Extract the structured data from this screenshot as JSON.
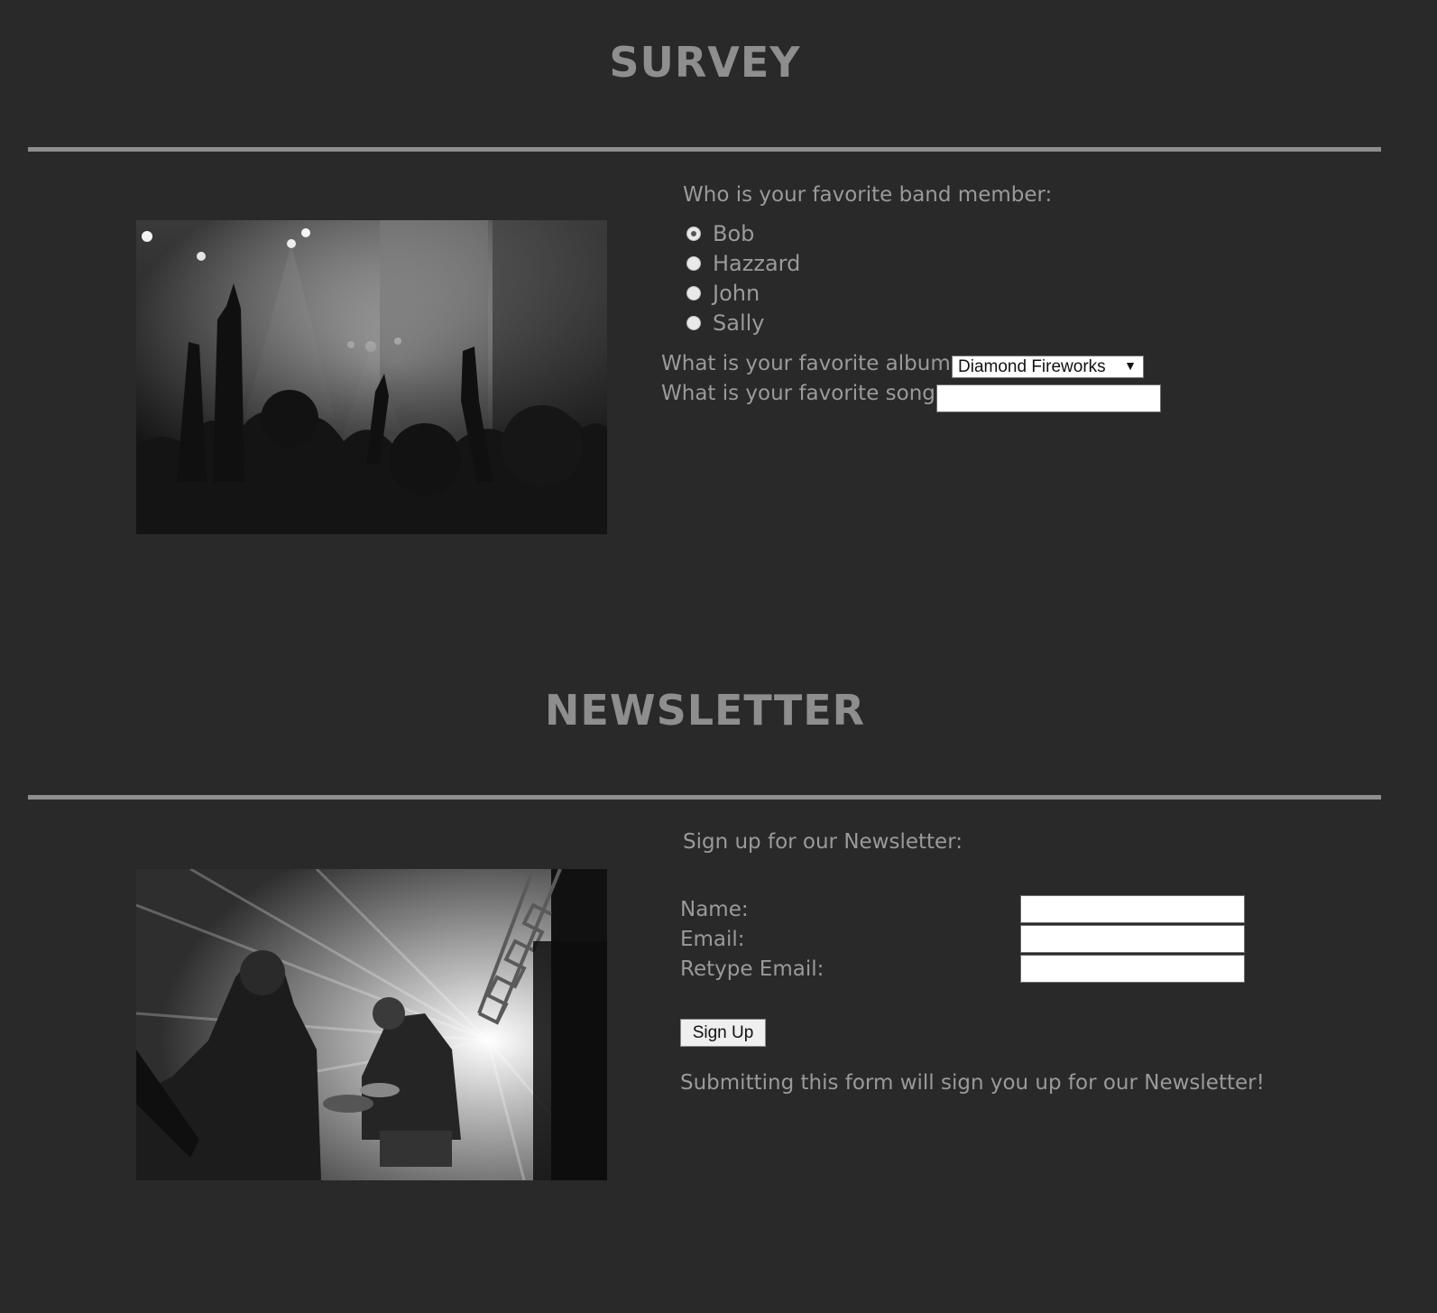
{
  "survey": {
    "title": "SURVEY",
    "photo": "concert-crowd-photo",
    "band_member_question": "Who is your favorite band member:",
    "members": [
      {
        "label": "Bob",
        "checked": true
      },
      {
        "label": "Hazzard",
        "checked": false
      },
      {
        "label": "John",
        "checked": false
      },
      {
        "label": "Sally",
        "checked": false
      }
    ],
    "album_label": "What is your favorite album:",
    "album_selected": "Diamond Fireworks",
    "song_label": "What is your favorite song:",
    "song_value": ""
  },
  "newsletter": {
    "title": "NEWSLETTER",
    "photo": "band-on-stage-photo",
    "intro": "Sign up for our Newsletter:",
    "name_label": "Name:",
    "email_label": "Email:",
    "retype_label": "Retype Email:",
    "name_value": "",
    "email_value": "",
    "retype_value": "",
    "signup_button": "Sign Up",
    "footer_note": "Submitting this form will sign you up for our Newsletter!"
  },
  "colors": {
    "background": "#292929",
    "heading": "#8e8e8e",
    "text": "#9a9a9a"
  }
}
